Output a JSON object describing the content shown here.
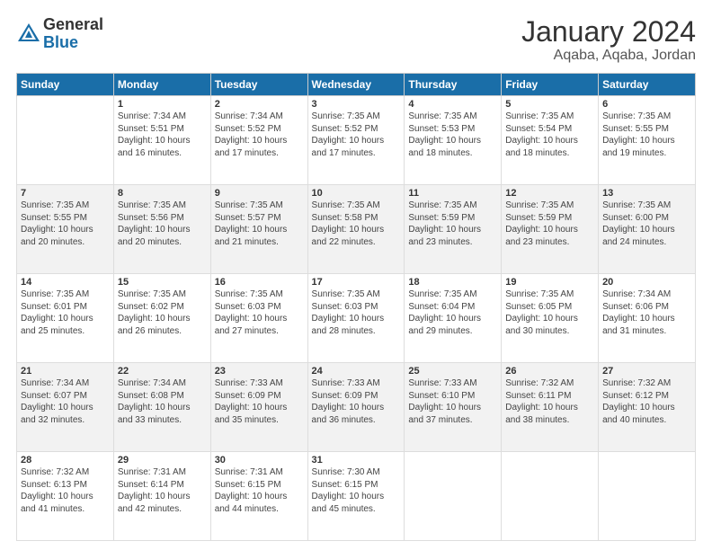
{
  "logo": {
    "general": "General",
    "blue": "Blue"
  },
  "title": "January 2024",
  "subtitle": "Aqaba, Aqaba, Jordan",
  "days": [
    "Sunday",
    "Monday",
    "Tuesday",
    "Wednesday",
    "Thursday",
    "Friday",
    "Saturday"
  ],
  "weeks": [
    [
      {
        "date": "",
        "sunrise": "",
        "sunset": "",
        "daylight": ""
      },
      {
        "date": "1",
        "sunrise": "Sunrise: 7:34 AM",
        "sunset": "Sunset: 5:51 PM",
        "daylight": "Daylight: 10 hours and 16 minutes."
      },
      {
        "date": "2",
        "sunrise": "Sunrise: 7:34 AM",
        "sunset": "Sunset: 5:52 PM",
        "daylight": "Daylight: 10 hours and 17 minutes."
      },
      {
        "date": "3",
        "sunrise": "Sunrise: 7:35 AM",
        "sunset": "Sunset: 5:52 PM",
        "daylight": "Daylight: 10 hours and 17 minutes."
      },
      {
        "date": "4",
        "sunrise": "Sunrise: 7:35 AM",
        "sunset": "Sunset: 5:53 PM",
        "daylight": "Daylight: 10 hours and 18 minutes."
      },
      {
        "date": "5",
        "sunrise": "Sunrise: 7:35 AM",
        "sunset": "Sunset: 5:54 PM",
        "daylight": "Daylight: 10 hours and 18 minutes."
      },
      {
        "date": "6",
        "sunrise": "Sunrise: 7:35 AM",
        "sunset": "Sunset: 5:55 PM",
        "daylight": "Daylight: 10 hours and 19 minutes."
      }
    ],
    [
      {
        "date": "7",
        "sunrise": "Sunrise: 7:35 AM",
        "sunset": "Sunset: 5:55 PM",
        "daylight": "Daylight: 10 hours and 20 minutes."
      },
      {
        "date": "8",
        "sunrise": "Sunrise: 7:35 AM",
        "sunset": "Sunset: 5:56 PM",
        "daylight": "Daylight: 10 hours and 20 minutes."
      },
      {
        "date": "9",
        "sunrise": "Sunrise: 7:35 AM",
        "sunset": "Sunset: 5:57 PM",
        "daylight": "Daylight: 10 hours and 21 minutes."
      },
      {
        "date": "10",
        "sunrise": "Sunrise: 7:35 AM",
        "sunset": "Sunset: 5:58 PM",
        "daylight": "Daylight: 10 hours and 22 minutes."
      },
      {
        "date": "11",
        "sunrise": "Sunrise: 7:35 AM",
        "sunset": "Sunset: 5:59 PM",
        "daylight": "Daylight: 10 hours and 23 minutes."
      },
      {
        "date": "12",
        "sunrise": "Sunrise: 7:35 AM",
        "sunset": "Sunset: 5:59 PM",
        "daylight": "Daylight: 10 hours and 23 minutes."
      },
      {
        "date": "13",
        "sunrise": "Sunrise: 7:35 AM",
        "sunset": "Sunset: 6:00 PM",
        "daylight": "Daylight: 10 hours and 24 minutes."
      }
    ],
    [
      {
        "date": "14",
        "sunrise": "Sunrise: 7:35 AM",
        "sunset": "Sunset: 6:01 PM",
        "daylight": "Daylight: 10 hours and 25 minutes."
      },
      {
        "date": "15",
        "sunrise": "Sunrise: 7:35 AM",
        "sunset": "Sunset: 6:02 PM",
        "daylight": "Daylight: 10 hours and 26 minutes."
      },
      {
        "date": "16",
        "sunrise": "Sunrise: 7:35 AM",
        "sunset": "Sunset: 6:03 PM",
        "daylight": "Daylight: 10 hours and 27 minutes."
      },
      {
        "date": "17",
        "sunrise": "Sunrise: 7:35 AM",
        "sunset": "Sunset: 6:03 PM",
        "daylight": "Daylight: 10 hours and 28 minutes."
      },
      {
        "date": "18",
        "sunrise": "Sunrise: 7:35 AM",
        "sunset": "Sunset: 6:04 PM",
        "daylight": "Daylight: 10 hours and 29 minutes."
      },
      {
        "date": "19",
        "sunrise": "Sunrise: 7:35 AM",
        "sunset": "Sunset: 6:05 PM",
        "daylight": "Daylight: 10 hours and 30 minutes."
      },
      {
        "date": "20",
        "sunrise": "Sunrise: 7:34 AM",
        "sunset": "Sunset: 6:06 PM",
        "daylight": "Daylight: 10 hours and 31 minutes."
      }
    ],
    [
      {
        "date": "21",
        "sunrise": "Sunrise: 7:34 AM",
        "sunset": "Sunset: 6:07 PM",
        "daylight": "Daylight: 10 hours and 32 minutes."
      },
      {
        "date": "22",
        "sunrise": "Sunrise: 7:34 AM",
        "sunset": "Sunset: 6:08 PM",
        "daylight": "Daylight: 10 hours and 33 minutes."
      },
      {
        "date": "23",
        "sunrise": "Sunrise: 7:33 AM",
        "sunset": "Sunset: 6:09 PM",
        "daylight": "Daylight: 10 hours and 35 minutes."
      },
      {
        "date": "24",
        "sunrise": "Sunrise: 7:33 AM",
        "sunset": "Sunset: 6:09 PM",
        "daylight": "Daylight: 10 hours and 36 minutes."
      },
      {
        "date": "25",
        "sunrise": "Sunrise: 7:33 AM",
        "sunset": "Sunset: 6:10 PM",
        "daylight": "Daylight: 10 hours and 37 minutes."
      },
      {
        "date": "26",
        "sunrise": "Sunrise: 7:32 AM",
        "sunset": "Sunset: 6:11 PM",
        "daylight": "Daylight: 10 hours and 38 minutes."
      },
      {
        "date": "27",
        "sunrise": "Sunrise: 7:32 AM",
        "sunset": "Sunset: 6:12 PM",
        "daylight": "Daylight: 10 hours and 40 minutes."
      }
    ],
    [
      {
        "date": "28",
        "sunrise": "Sunrise: 7:32 AM",
        "sunset": "Sunset: 6:13 PM",
        "daylight": "Daylight: 10 hours and 41 minutes."
      },
      {
        "date": "29",
        "sunrise": "Sunrise: 7:31 AM",
        "sunset": "Sunset: 6:14 PM",
        "daylight": "Daylight: 10 hours and 42 minutes."
      },
      {
        "date": "30",
        "sunrise": "Sunrise: 7:31 AM",
        "sunset": "Sunset: 6:15 PM",
        "daylight": "Daylight: 10 hours and 44 minutes."
      },
      {
        "date": "31",
        "sunrise": "Sunrise: 7:30 AM",
        "sunset": "Sunset: 6:15 PM",
        "daylight": "Daylight: 10 hours and 45 minutes."
      },
      {
        "date": "",
        "sunrise": "",
        "sunset": "",
        "daylight": ""
      },
      {
        "date": "",
        "sunrise": "",
        "sunset": "",
        "daylight": ""
      },
      {
        "date": "",
        "sunrise": "",
        "sunset": "",
        "daylight": ""
      }
    ]
  ]
}
